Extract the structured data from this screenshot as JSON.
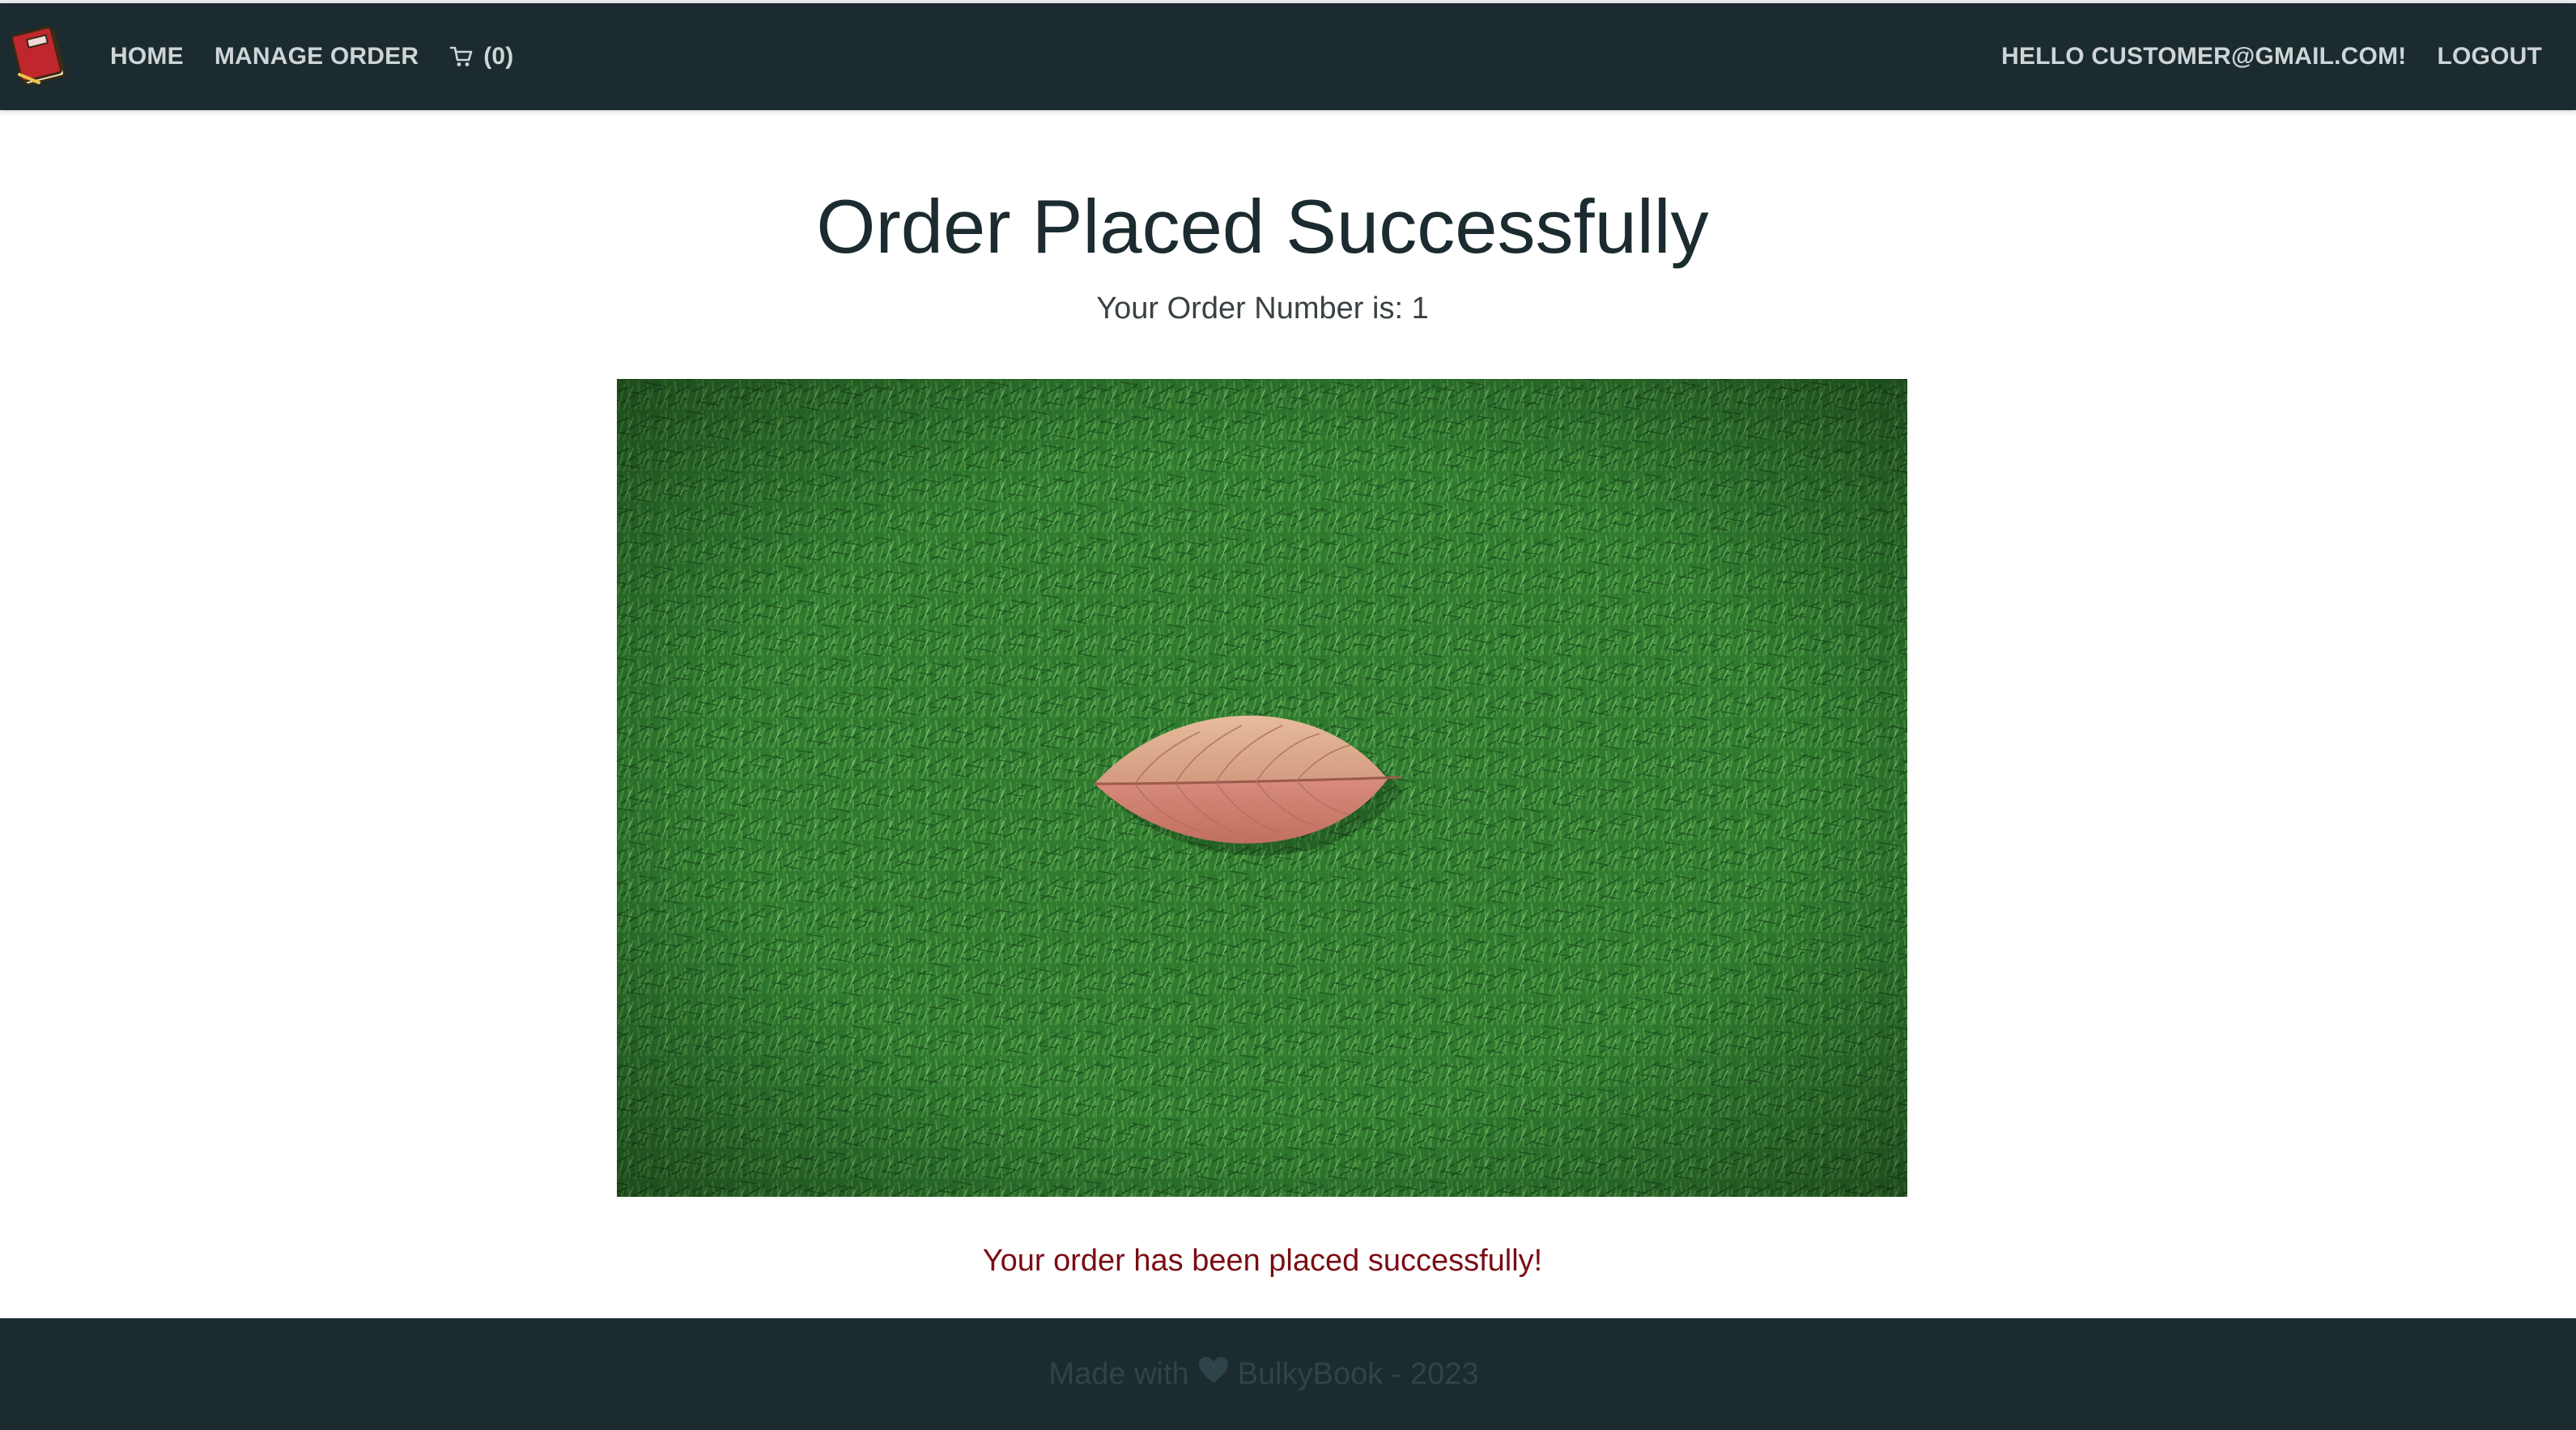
{
  "nav": {
    "brand_icon": "book-logo-icon",
    "home": "HOME",
    "manage_order": "MANAGE ORDER",
    "cart_count": "(0)",
    "greeting": "HELLO CUSTOMER@GMAIL.COM!",
    "logout": "LOGOUT"
  },
  "main": {
    "title": "Order Placed Successfully",
    "order_number": "Your Order Number is: 1",
    "image_subject": "leaf-on-grass",
    "success_message": "Your order has been placed successfully!"
  },
  "footer": {
    "made_with": "Made with",
    "heart_icon": "heart-icon",
    "credit": "BulkyBook - 2023"
  },
  "colors": {
    "navbar": "#1b2b2f",
    "title": "#1b2b2f",
    "success_message": "#7a0d14",
    "footer_text": "#2f4449"
  }
}
